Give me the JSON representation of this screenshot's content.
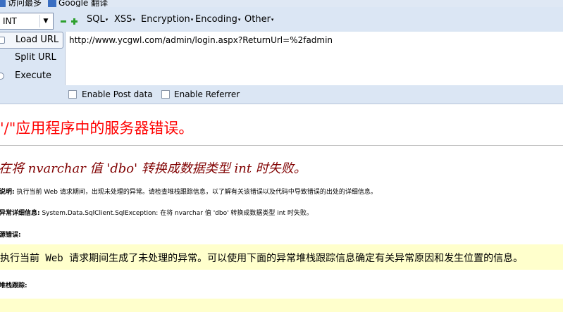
{
  "bookmarks": {
    "items": [
      {
        "label": "访问最多"
      },
      {
        "label": "Google 翻译"
      }
    ]
  },
  "hackbar": {
    "select_value": "INT",
    "menus": [
      {
        "label": "SQL"
      },
      {
        "label": "XSS"
      },
      {
        "label": "Encryption"
      },
      {
        "label": "Encoding"
      },
      {
        "label": "Other"
      }
    ],
    "buttons": {
      "load_url": "Load URL",
      "split_url": "Split URL",
      "execute": "Execute"
    },
    "url_value": "http://www.ycgwl.com/admin/login.aspx?ReturnUrl=%2fadmin",
    "options": {
      "post_data": "Enable Post data",
      "referrer": "Enable Referrer"
    }
  },
  "error_page": {
    "title": "\"/\"应用程序中的服务器错误。",
    "subtitle": "在将 nvarchar 值 'dbo' 转换成数据类型 int 时失败。",
    "description_label": "说明:",
    "description_text": " 执行当前 Web 请求期间，出现未处理的异常。请检查堆栈跟踪信息，以了解有关该错误以及代码中导致错误的出处的详细信息。",
    "exception_label": "异常详细信息:",
    "exception_text": " System.Data.SqlClient.SqlException: 在将 nvarchar 值 'dbo' 转换成数据类型 int 时失败。",
    "source_label": "源错误:",
    "source_text": "执行当前 Web 请求期间生成了未处理的异常。可以使用下面的异常堆栈跟踪信息确定有关异常原因和发生位置的信息。",
    "stack_label": "堆栈跟踪:"
  }
}
